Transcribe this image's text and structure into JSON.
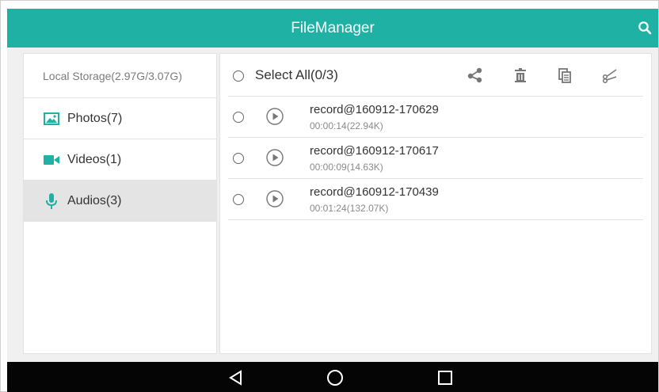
{
  "titlebar": {
    "title": "FileManager",
    "search_icon": "search-icon"
  },
  "sidebar": {
    "storage": "Local Storage(2.97G/3.07G)",
    "items": [
      {
        "label": "Photos(7)",
        "icon": "photo-icon",
        "color": "#1fb1a3"
      },
      {
        "label": "Videos(1)",
        "icon": "video-camera-icon",
        "color": "#1fb1a3"
      },
      {
        "label": "Audios(3)",
        "icon": "microphone-icon",
        "color": "#1fb1a3",
        "active": true
      }
    ]
  },
  "main": {
    "select_all": "Select All(0/3)",
    "toolbar": [
      "share-icon",
      "delete-icon",
      "copy-icon",
      "cut-icon"
    ],
    "files": [
      {
        "name": "record@160912-170629",
        "meta": "00:00:14(22.94K)"
      },
      {
        "name": "record@160912-170617",
        "meta": "00:00:09(14.63K)"
      },
      {
        "name": "record@160912-170439",
        "meta": "00:01:24(132.07K)"
      }
    ]
  },
  "navbar": {
    "buttons": [
      "back-icon",
      "home-icon",
      "recents-icon"
    ]
  },
  "colors": {
    "accent": "#1fb1a3",
    "navbar": "#050505",
    "active_item": "#e4e4e4"
  }
}
